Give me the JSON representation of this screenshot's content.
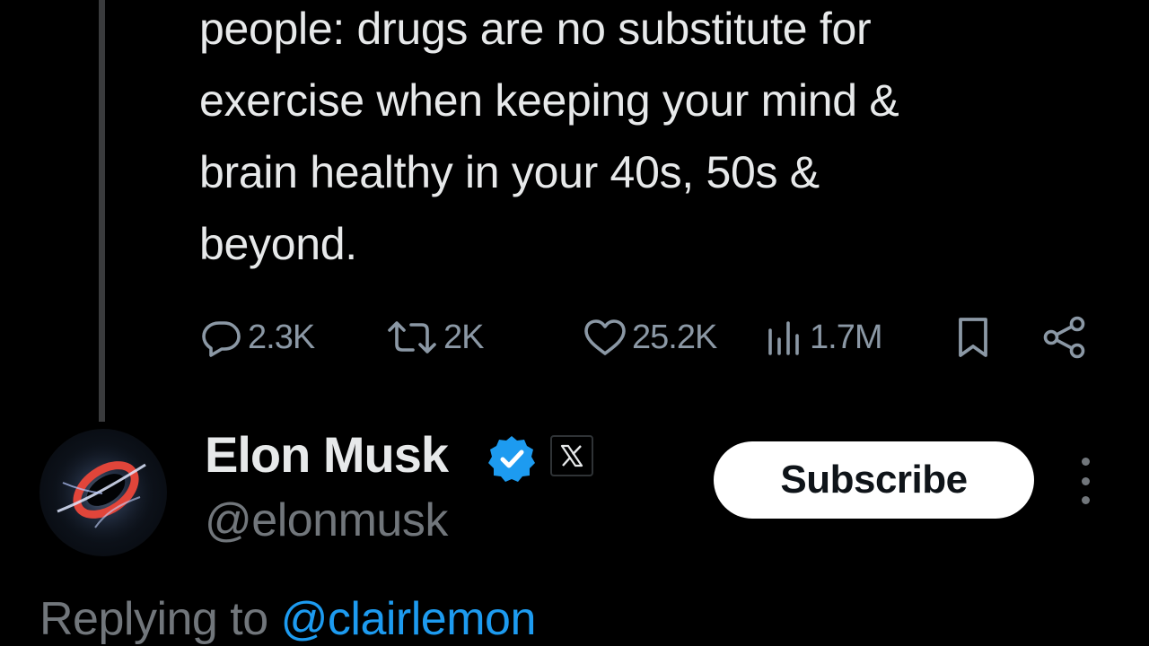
{
  "tweet": {
    "text_lines": [
      "people: drugs are no substitute for",
      "exercise when keeping your mind &",
      "brain healthy in your 40s, 50s &",
      "beyond."
    ]
  },
  "actions": {
    "replies": "2.3K",
    "reposts": "2K",
    "likes": "25.2K",
    "views": "1.7M"
  },
  "reply_author": {
    "name": "Elon Musk",
    "handle": "@elonmusk",
    "verified_icon": "verified-badge-icon",
    "affiliate_icon": "x-logo-icon"
  },
  "subscribe_label": "Subscribe",
  "replying": {
    "prefix": "Replying to ",
    "mention": "@clairlemon"
  },
  "colors": {
    "background": "#000000",
    "text_primary": "#e7e9ea",
    "text_secondary": "#71767b",
    "accent": "#1d9bf0"
  }
}
